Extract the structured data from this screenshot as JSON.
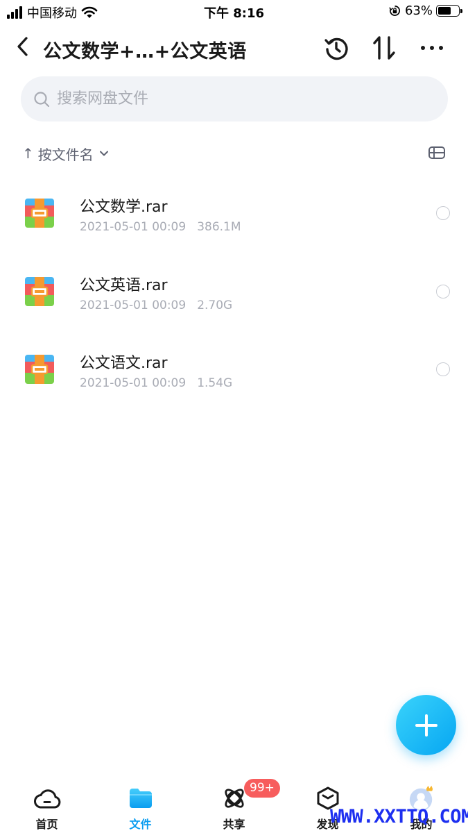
{
  "status_bar": {
    "carrier": "中国移动",
    "time": "下午 8:16",
    "battery_percent": "63%",
    "battery_level": 0.63
  },
  "header": {
    "title": "公文数学+…+公文英语",
    "icons": [
      "back-arrow-icon",
      "history-icon",
      "sort-transfer-icon",
      "more-icon"
    ]
  },
  "search": {
    "placeholder": "搜索网盘文件"
  },
  "sort": {
    "label": "按文件名",
    "direction_symbol": "↑"
  },
  "files": [
    {
      "name": "公文数学.rar",
      "date": "2021-05-01 00:09",
      "size": "386.1M",
      "icon": "rar-archive-icon"
    },
    {
      "name": "公文英语.rar",
      "date": "2021-05-01 00:09",
      "size": "2.70G",
      "icon": "rar-archive-icon"
    },
    {
      "name": "公文语文.rar",
      "date": "2021-05-01 00:09",
      "size": "1.54G",
      "icon": "rar-archive-icon"
    }
  ],
  "tabbar": {
    "tabs": [
      {
        "label": "首页",
        "icon": "cloud-icon",
        "active": false
      },
      {
        "label": "文件",
        "icon": "folder-icon",
        "active": true
      },
      {
        "label": "共享",
        "icon": "planet-icon",
        "active": false,
        "badge": "99+"
      },
      {
        "label": "发现",
        "icon": "box-icon",
        "active": false
      },
      {
        "label": "我的",
        "icon": "avatar-icon",
        "active": false
      }
    ]
  },
  "colors": {
    "accent": "#0a9df0",
    "fab_gradient_start": "#3ad3fb",
    "fab_gradient_end": "#06a6f2",
    "badge": "#f75d5d",
    "secondary_text": "#a9acb5"
  },
  "watermark": "WWW.XXTTQ.COM"
}
